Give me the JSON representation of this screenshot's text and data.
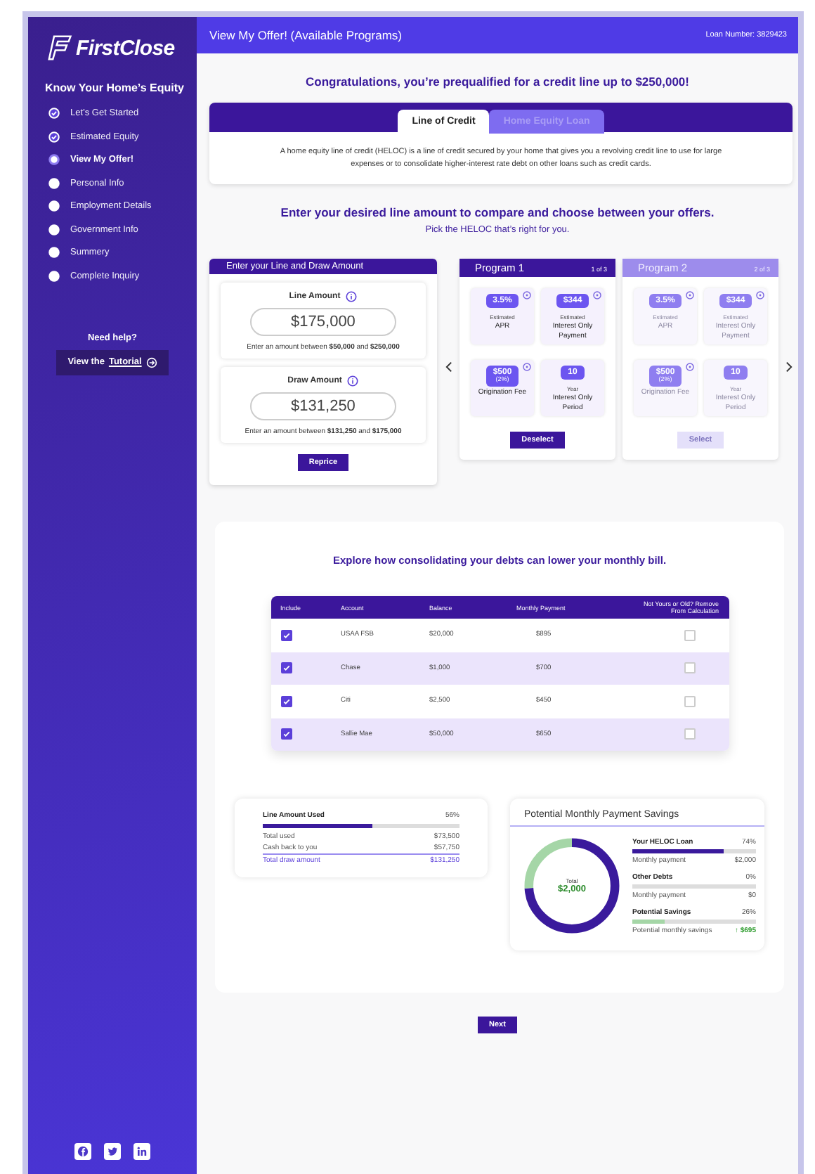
{
  "sidebar": {
    "logo": "FirstClose",
    "section_title": "Know Your Home’s Equity",
    "steps": [
      {
        "label": "Let’s Get Started",
        "completed": true,
        "selected": false
      },
      {
        "label": "Estimated Equity",
        "completed": true,
        "selected": false
      },
      {
        "label": "View My Offer!",
        "completed": false,
        "selected": true
      },
      {
        "label": "Personal Info",
        "completed": false,
        "selected": false
      },
      {
        "label": "Employment Details",
        "completed": false,
        "selected": false
      },
      {
        "label": "Government Info",
        "completed": false,
        "selected": false
      },
      {
        "label": "Summery",
        "completed": false,
        "selected": false
      },
      {
        "label": "Complete Inquiry",
        "completed": false,
        "selected": false
      }
    ],
    "help_title": "Need help?",
    "help_button": {
      "prefix": "View the",
      "link": "Tutorial"
    },
    "social": [
      {
        "kind": "facebook"
      },
      {
        "kind": "twitter"
      },
      {
        "kind": "linkedin"
      }
    ]
  },
  "header": {
    "title": "View My Offer! (Available Programs)",
    "loan_number": "Loan Number: 3829423"
  },
  "headline": "Congratulations, you’re prequalified for a credit line up to $250,000!",
  "tabs": [
    {
      "label": "Line of Credit",
      "selected": true
    },
    {
      "label": "Home Equity Loan",
      "selected": false
    }
  ],
  "tab_description": "A home equity line of credit (HELOC) is a line of credit secured by your home that gives you a revolving credit line to use for large expenses or to consolidate higher-interest rate debt on other loans such as credit cards.",
  "compare_title": "Enter your desired line amount to compare and choose between your offers.",
  "compare_subtitle": "Pick the HELOC that’s right for you.",
  "amount_panel": {
    "title": "Enter your Line and Draw Amount",
    "fields": [
      {
        "label": "Line Amount",
        "value": "$175,000",
        "hint": "Enter an amount between **$50,000** and **$250,000**"
      },
      {
        "label": "Draw Amount",
        "value": "$131,250",
        "hint": "Enter an amount between **$131,250** and **$175,000**"
      }
    ],
    "button": "Reprice"
  },
  "programs": [
    {
      "name": "Program 1",
      "position": "1 of 3",
      "selected": true,
      "button": "Deselect",
      "tiles": [
        {
          "badge": "3.5%",
          "over": "Estimated",
          "label": "APR",
          "info": true
        },
        {
          "badge": "$344",
          "over": "Estimated",
          "label": "Interest Only Payment",
          "info": true
        },
        {
          "badge": "$500",
          "note": "(2%)",
          "label": "Origination Fee",
          "info": true
        },
        {
          "badge": "10",
          "over": "Year",
          "label": "Interest Only Period",
          "info": false
        }
      ]
    },
    {
      "name": "Program 2",
      "position": "2 of 3",
      "selected": false,
      "button": "Select",
      "tiles": [
        {
          "badge": "3.5%",
          "over": "Estimated",
          "label": "APR",
          "info": true
        },
        {
          "badge": "$344",
          "over": "Estimated",
          "label": "Interest Only Payment",
          "info": true
        },
        {
          "badge": "$500",
          "note": "(2%)",
          "label": "Origination Fee",
          "info": true
        },
        {
          "badge": "10",
          "over": "Year",
          "label": "Interest Only Period",
          "info": false
        }
      ]
    }
  ],
  "debts": {
    "title": "Explore how consolidating your debts can lower your monthly bill.",
    "columns": [
      "Include",
      "Account",
      "Balance",
      "Monthly Payment",
      "Not Yours or Old? Remove From Calculation"
    ],
    "rows": [
      {
        "account": "USAA FSB",
        "balance": "$20,000",
        "payment": "$895",
        "include": true,
        "remove": false
      },
      {
        "account": "Chase",
        "balance": "$1,000",
        "payment": "$700",
        "include": true,
        "remove": false
      },
      {
        "account": "Citi",
        "balance": "$2,500",
        "payment": "$450",
        "include": true,
        "remove": false
      },
      {
        "account": "Sallie Mae",
        "balance": "$50,000",
        "payment": "$650",
        "include": true,
        "remove": false
      }
    ]
  },
  "line_usage": {
    "title": "Line Amount Used",
    "percent": "56%",
    "level": 0.56,
    "rows": [
      {
        "label": "Total used",
        "value": "$73,500"
      },
      {
        "label": "Cash back to you",
        "value": "$57,750"
      }
    ],
    "total": {
      "label": "Total draw amount",
      "value": "$131,250"
    }
  },
  "savings": {
    "title": "Potential Monthly Payment Savings",
    "donut_label": "Total",
    "donut_value": "$2,000",
    "items": [
      {
        "name": "Your HELOC Loan",
        "percent": "74%",
        "level": 0.74,
        "color": "#3a1a9c",
        "sub_label": "Monthly payment",
        "sub_value": "$2,000",
        "highlight": false
      },
      {
        "name": "Other Debts",
        "percent": "0%",
        "sub_label": "Monthly payment",
        "sub_value": "$0",
        "highlight": false
      },
      {
        "name": "Potential Savings",
        "percent": "26%",
        "level": 0.26,
        "color": "#a5d6a7",
        "sub_label": "Potential monthly savings",
        "sub_value": "↑ $695",
        "highlight": true
      }
    ]
  },
  "next_button": "Next"
}
